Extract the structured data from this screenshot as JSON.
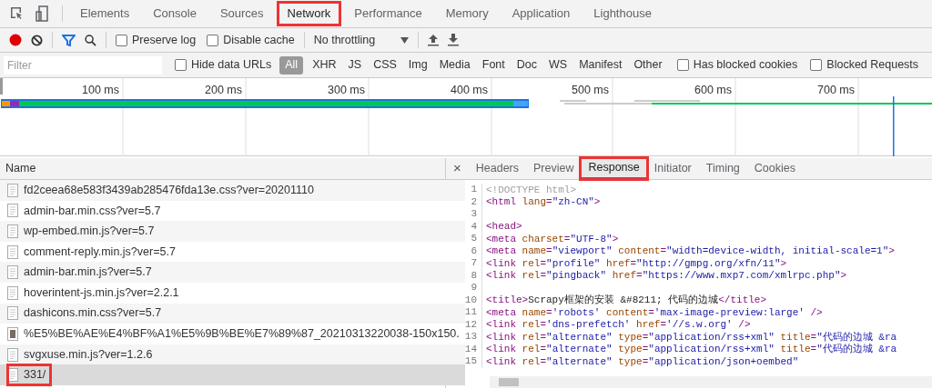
{
  "main_tabs": [
    {
      "label": "Elements",
      "selected": false,
      "annotated": false
    },
    {
      "label": "Console",
      "selected": false,
      "annotated": false
    },
    {
      "label": "Sources",
      "selected": false,
      "annotated": false
    },
    {
      "label": "Network",
      "selected": true,
      "annotated": true
    },
    {
      "label": "Performance",
      "selected": false,
      "annotated": false
    },
    {
      "label": "Memory",
      "selected": false,
      "annotated": false
    },
    {
      "label": "Application",
      "selected": false,
      "annotated": false
    },
    {
      "label": "Lighthouse",
      "selected": false,
      "annotated": false
    }
  ],
  "toolbar": {
    "recording": true,
    "filter_on": true,
    "checkboxes": [
      {
        "label": "Preserve log",
        "checked": false
      },
      {
        "label": "Disable cache",
        "checked": false
      }
    ],
    "throttling": "No throttling"
  },
  "filter_bar": {
    "placeholder": "Filter",
    "hide_data_urls": {
      "label": "Hide data URLs",
      "checked": false
    },
    "types": [
      {
        "label": "All",
        "selected": true
      },
      {
        "label": "XHR",
        "selected": false
      },
      {
        "label": "JS",
        "selected": false
      },
      {
        "label": "CSS",
        "selected": false
      },
      {
        "label": "Img",
        "selected": false
      },
      {
        "label": "Media",
        "selected": false
      },
      {
        "label": "Font",
        "selected": false
      },
      {
        "label": "Doc",
        "selected": false
      },
      {
        "label": "WS",
        "selected": false
      },
      {
        "label": "Manifest",
        "selected": false
      },
      {
        "label": "Other",
        "selected": false
      }
    ],
    "checkboxes": [
      {
        "label": "Has blocked cookies",
        "checked": false
      },
      {
        "label": "Blocked Requests",
        "checked": false
      }
    ]
  },
  "timeline": {
    "ticks": [
      "100 ms",
      "200 ms",
      "300 ms",
      "400 ms",
      "500 ms",
      "600 ms",
      "700 ms"
    ]
  },
  "requests": {
    "column": "Name",
    "rows": [
      {
        "name": "fd2ceea68e583f3439ab285476fda13e.css?ver=20201110",
        "kind": "doc",
        "selected": false,
        "annotated": false
      },
      {
        "name": "admin-bar.min.css?ver=5.7",
        "kind": "doc",
        "selected": false,
        "annotated": false
      },
      {
        "name": "wp-embed.min.js?ver=5.7",
        "kind": "doc",
        "selected": false,
        "annotated": false
      },
      {
        "name": "comment-reply.min.js?ver=5.7",
        "kind": "doc",
        "selected": false,
        "annotated": false
      },
      {
        "name": "admin-bar.min.js?ver=5.7",
        "kind": "doc",
        "selected": false,
        "annotated": false
      },
      {
        "name": "hoverintent-js.min.js?ver=2.2.1",
        "kind": "doc",
        "selected": false,
        "annotated": false
      },
      {
        "name": "dashicons.min.css?ver=5.7",
        "kind": "doc",
        "selected": false,
        "annotated": false
      },
      {
        "name": "%E5%BE%AE%E4%BF%A1%E5%9B%BE%E7%89%87_20210313220038-150x150.",
        "kind": "image",
        "selected": false,
        "annotated": false
      },
      {
        "name": "svgxuse.min.js?ver=1.2.6",
        "kind": "doc",
        "selected": false,
        "annotated": false
      },
      {
        "name": "331/",
        "kind": "doc",
        "selected": true,
        "annotated": true
      }
    ]
  },
  "detail": {
    "close": "×",
    "tabs": [
      {
        "label": "Headers",
        "selected": false,
        "annotated": false
      },
      {
        "label": "Preview",
        "selected": false,
        "annotated": false
      },
      {
        "label": "Response",
        "selected": true,
        "annotated": true
      },
      {
        "label": "Initiator",
        "selected": false,
        "annotated": false
      },
      {
        "label": "Timing",
        "selected": false,
        "annotated": false
      },
      {
        "label": "Cookies",
        "selected": false,
        "annotated": false
      }
    ],
    "lines": [
      {
        "number": "1",
        "tokens": [
          {
            "kind": "doctype",
            "text": "<!DOCTYPE html>"
          }
        ]
      },
      {
        "number": "2",
        "tokens": [
          {
            "kind": "tag",
            "text": "<html "
          },
          {
            "kind": "attr",
            "text": "lang"
          },
          {
            "kind": "tag",
            "text": "="
          },
          {
            "kind": "value",
            "text": "\"zh-CN\""
          },
          {
            "kind": "tag",
            "text": ">"
          }
        ]
      },
      {
        "number": "3"
      },
      {
        "number": "4",
        "tokens": [
          {
            "kind": "tag",
            "text": "<head>"
          }
        ]
      },
      {
        "number": "5",
        "tokens": [
          {
            "kind": "tag",
            "text": "<meta "
          },
          {
            "kind": "attr",
            "text": "charset"
          },
          {
            "kind": "tag",
            "text": "="
          },
          {
            "kind": "value",
            "text": "\"UTF-8\""
          },
          {
            "kind": "tag",
            "text": ">"
          }
        ]
      },
      {
        "number": "6",
        "tokens": [
          {
            "kind": "tag",
            "text": "<meta "
          },
          {
            "kind": "attr",
            "text": "name"
          },
          {
            "kind": "tag",
            "text": "="
          },
          {
            "kind": "value",
            "text": "\"viewport\""
          },
          {
            "kind": "attr",
            "text": " content"
          },
          {
            "kind": "tag",
            "text": "="
          },
          {
            "kind": "value",
            "text": "\"width=device-width, initial-scale=1\""
          },
          {
            "kind": "tag",
            "text": ">"
          }
        ]
      },
      {
        "number": "7",
        "tokens": [
          {
            "kind": "tag",
            "text": "<link "
          },
          {
            "kind": "attr",
            "text": "rel"
          },
          {
            "kind": "tag",
            "text": "="
          },
          {
            "kind": "value",
            "text": "\"profile\""
          },
          {
            "kind": "attr",
            "text": " href"
          },
          {
            "kind": "tag",
            "text": "="
          },
          {
            "kind": "value",
            "text": "\"http://gmpg.org/xfn/11\""
          },
          {
            "kind": "tag",
            "text": ">"
          }
        ]
      },
      {
        "number": "8",
        "tokens": [
          {
            "kind": "tag",
            "text": "<link "
          },
          {
            "kind": "attr",
            "text": "rel"
          },
          {
            "kind": "tag",
            "text": "="
          },
          {
            "kind": "value",
            "text": "\"pingback\""
          },
          {
            "kind": "attr",
            "text": " href"
          },
          {
            "kind": "tag",
            "text": "="
          },
          {
            "kind": "value",
            "text": "\"https://www.mxp7.com/xmlrpc.php\""
          },
          {
            "kind": "tag",
            "text": ">"
          }
        ]
      },
      {
        "number": "9"
      },
      {
        "number": "10",
        "tokens": [
          {
            "kind": "tag",
            "text": "<title>"
          },
          {
            "kind": "text",
            "text": "Scrapy框架的安装 &#8211; 代码的边城"
          },
          {
            "kind": "tag",
            "text": "</title>"
          }
        ]
      },
      {
        "number": "11",
        "tokens": [
          {
            "kind": "tag",
            "text": "<meta "
          },
          {
            "kind": "attr",
            "text": "name"
          },
          {
            "kind": "tag",
            "text": "="
          },
          {
            "kind": "value",
            "text": "'robots'"
          },
          {
            "kind": "attr",
            "text": " content"
          },
          {
            "kind": "tag",
            "text": "="
          },
          {
            "kind": "value",
            "text": "'max-image-preview:large'"
          },
          {
            "kind": "tag",
            "text": " />"
          }
        ]
      },
      {
        "number": "12",
        "tokens": [
          {
            "kind": "tag",
            "text": "<link "
          },
          {
            "kind": "attr",
            "text": "rel"
          },
          {
            "kind": "tag",
            "text": "="
          },
          {
            "kind": "value",
            "text": "'dns-prefetch'"
          },
          {
            "kind": "attr",
            "text": " href"
          },
          {
            "kind": "tag",
            "text": "="
          },
          {
            "kind": "value",
            "text": "'//s.w.org'"
          },
          {
            "kind": "tag",
            "text": " />"
          }
        ]
      },
      {
        "number": "13",
        "tokens": [
          {
            "kind": "tag",
            "text": "<link "
          },
          {
            "kind": "attr",
            "text": "rel"
          },
          {
            "kind": "tag",
            "text": "="
          },
          {
            "kind": "value",
            "text": "\"alternate\""
          },
          {
            "kind": "attr",
            "text": " type"
          },
          {
            "kind": "tag",
            "text": "="
          },
          {
            "kind": "value",
            "text": "\"application/rss+xml\""
          },
          {
            "kind": "attr",
            "text": " title"
          },
          {
            "kind": "tag",
            "text": "="
          },
          {
            "kind": "value",
            "text": "\"代码的边城 &ra"
          }
        ]
      },
      {
        "number": "14",
        "tokens": [
          {
            "kind": "tag",
            "text": "<link "
          },
          {
            "kind": "attr",
            "text": "rel"
          },
          {
            "kind": "tag",
            "text": "="
          },
          {
            "kind": "value",
            "text": "\"alternate\""
          },
          {
            "kind": "attr",
            "text": " type"
          },
          {
            "kind": "tag",
            "text": "="
          },
          {
            "kind": "value",
            "text": "\"application/rss+xml\""
          },
          {
            "kind": "attr",
            "text": " title"
          },
          {
            "kind": "tag",
            "text": "="
          },
          {
            "kind": "value",
            "text": "\"代码的边城 &ra"
          }
        ]
      },
      {
        "number": "15",
        "tokens": [
          {
            "kind": "tag",
            "text": "<link "
          },
          {
            "kind": "attr",
            "text": "rel"
          },
          {
            "kind": "tag",
            "text": "="
          },
          {
            "kind": "value",
            "text": "\"alternate\""
          },
          {
            "kind": "attr",
            "text": " type"
          },
          {
            "kind": "tag",
            "text": "="
          },
          {
            "kind": "value",
            "text": "\"application/json+oembed\""
          }
        ]
      }
    ]
  }
}
